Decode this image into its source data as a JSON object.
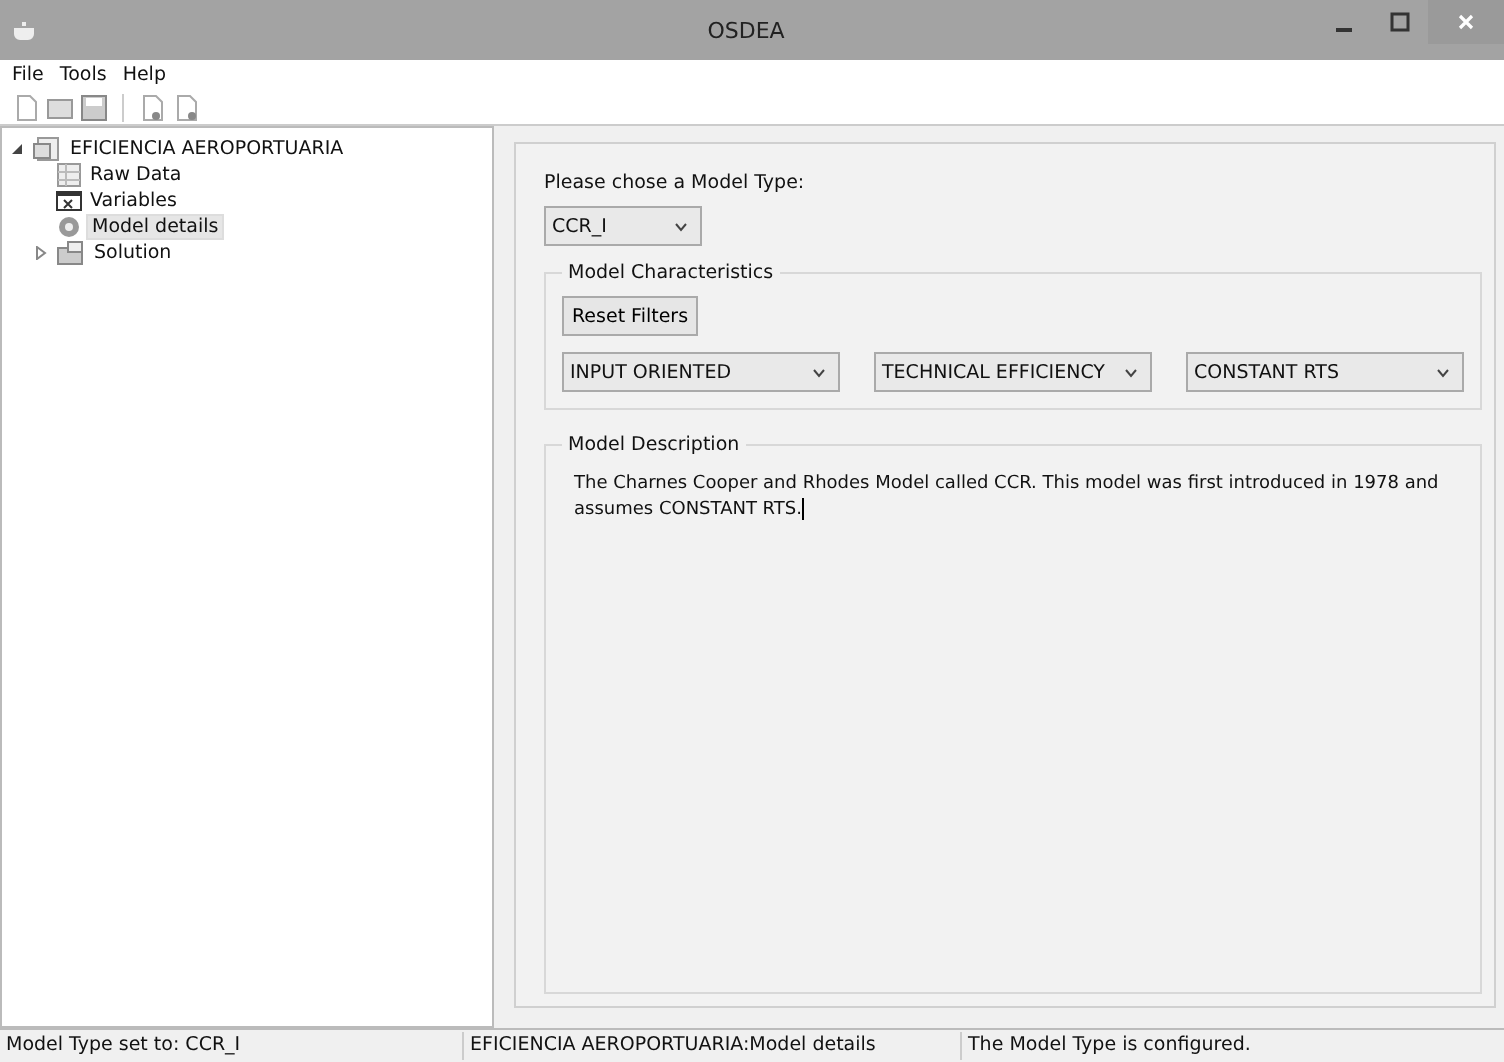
{
  "window": {
    "title": "OSDEA"
  },
  "menu": [
    "File",
    "Tools",
    "Help"
  ],
  "tree": [
    {
      "label": "EFICIENCIA AEROPORTUARIA",
      "expanded": true,
      "selected": false,
      "children": [
        {
          "label": "Raw Data",
          "selected": false
        },
        {
          "label": "Variables",
          "selected": false
        },
        {
          "label": "Model details",
          "selected": true
        },
        {
          "label": "Solution",
          "expanded": false,
          "selected": false
        }
      ]
    }
  ],
  "model_type": {
    "label": "Please chose a Model Type:",
    "value": "CCR_I"
  },
  "characteristics": {
    "title": "Model Characteristics",
    "reset_button": "Reset Filters",
    "filters": [
      "INPUT ORIENTED",
      "TECHNICAL EFFICIENCY",
      "CONSTANT RTS"
    ]
  },
  "description": {
    "title": "Model Description",
    "text": "The Charnes Cooper and Rhodes Model called CCR. This model was first introduced in 1978 and assumes CONSTANT RTS."
  },
  "status_bar": [
    "Model Type set to: CCR_I",
    "EFICIENCIA AEROPORTUARIA:Model details",
    "The Model Type is configured."
  ]
}
